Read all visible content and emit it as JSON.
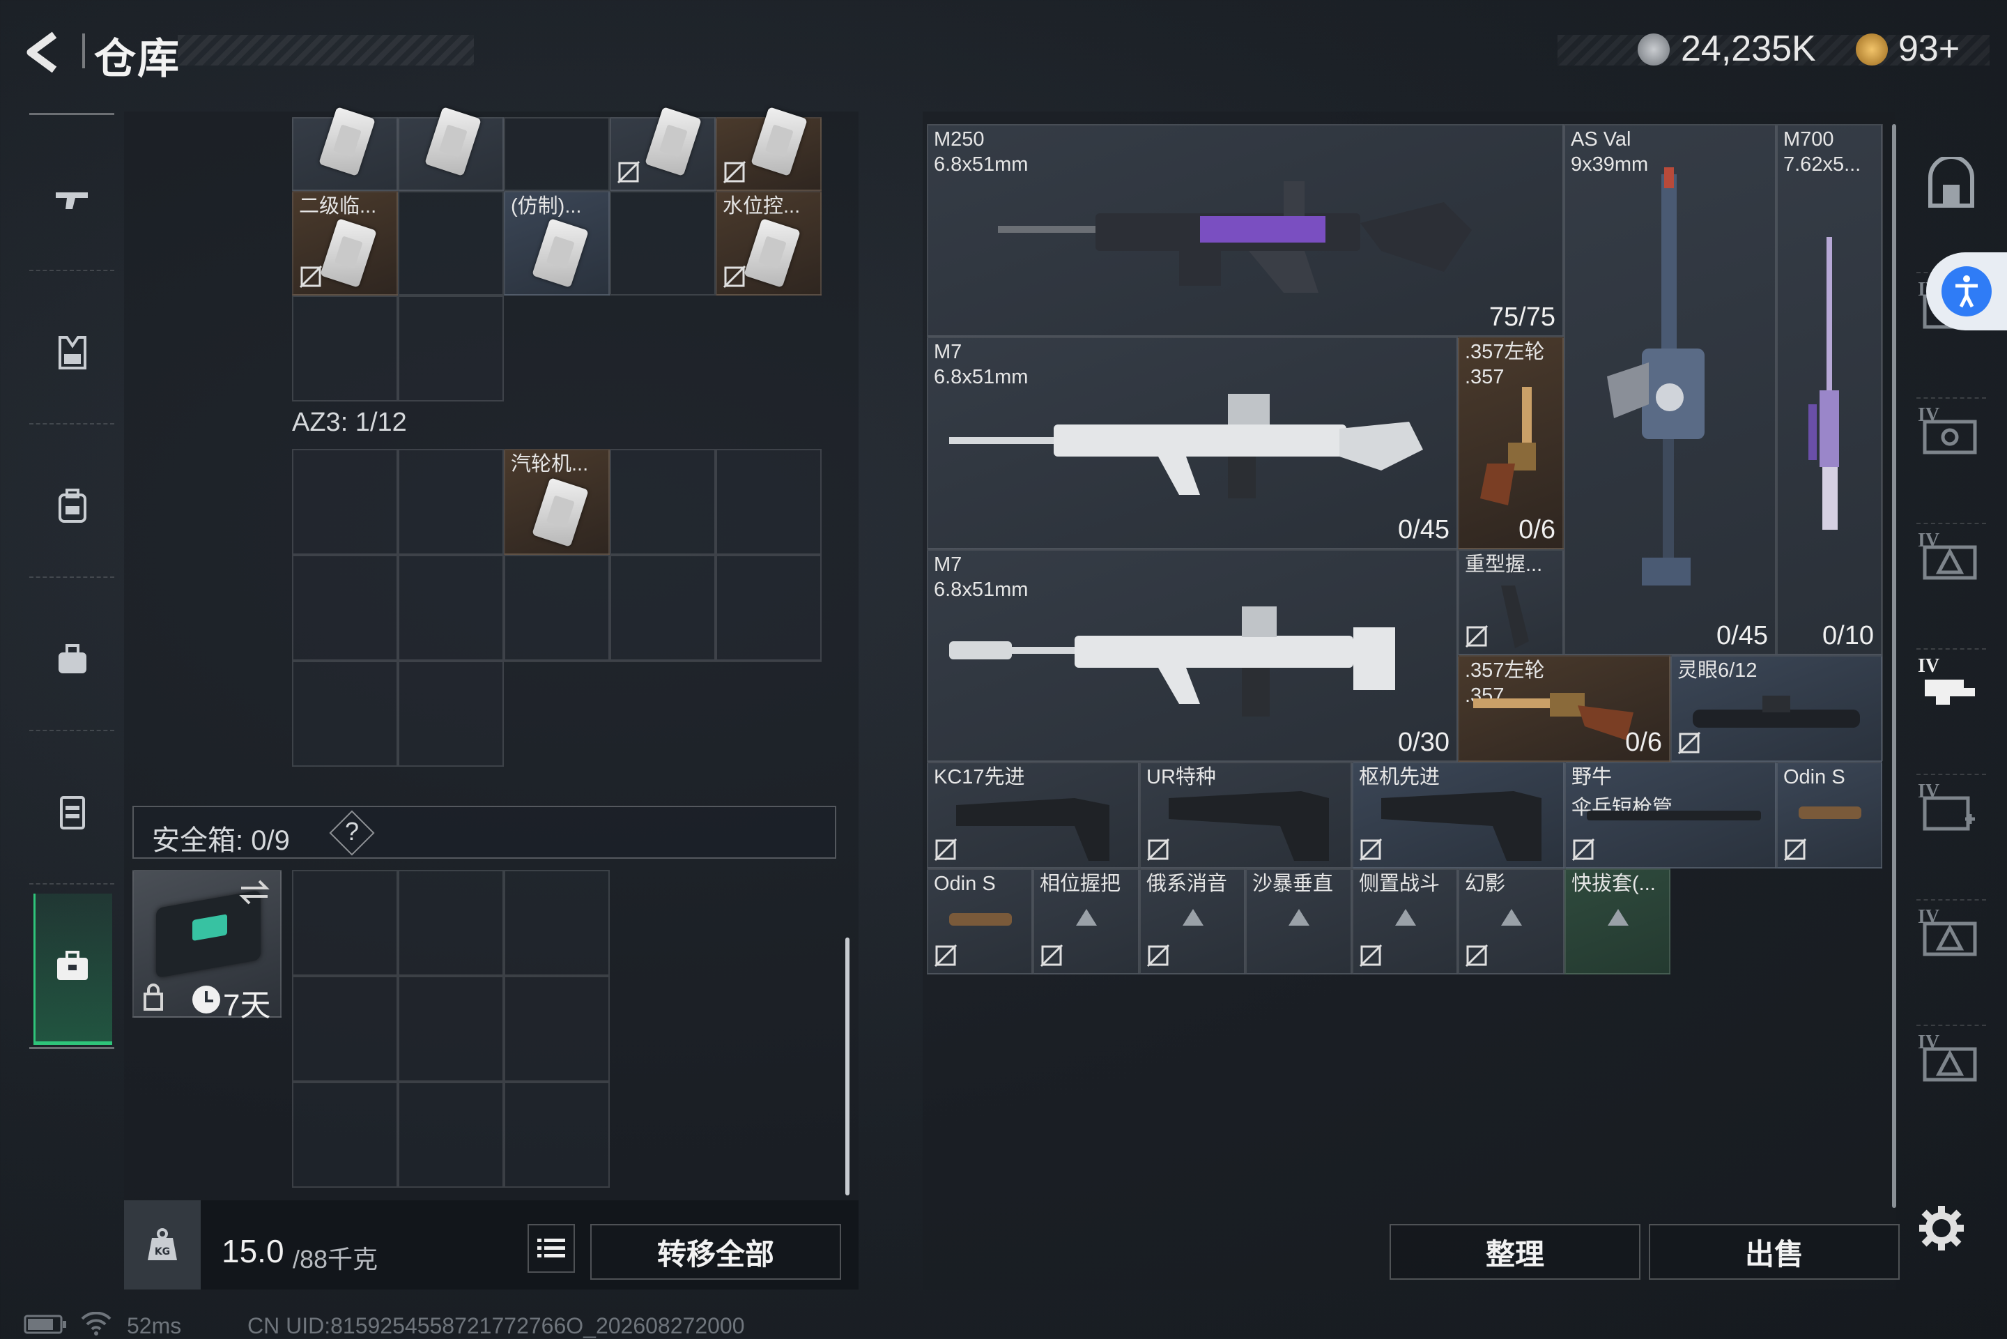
{
  "header": {
    "title": "仓库",
    "currency1": "24,235K",
    "currency2": "93+"
  },
  "left_panel": {
    "az3_label": "AZ3: 1/12",
    "items_top": [
      {
        "name": "二级临..."
      },
      {
        "name": "(仿制)..."
      },
      {
        "name": "水位控..."
      }
    ],
    "az3_item": {
      "name": "汽轮机..."
    },
    "safebox_label": "安全箱: 0/9",
    "safebox_help": "?",
    "safebox_duration": "7天",
    "weight_value": "15.0",
    "weight_max": "/88千克",
    "transfer_all": "转移全部"
  },
  "right_panel": {
    "items": [
      {
        "name": "M250",
        "sub": "6.8x51mm",
        "count": "75/75"
      },
      {
        "name": "AS Val",
        "sub": "9x39mm",
        "count": "0/45"
      },
      {
        "name": "M700",
        "sub": "7.62x5...",
        "count": "0/10"
      },
      {
        "name": "M7",
        "sub": "6.8x51mm",
        "count": "0/45"
      },
      {
        "name": ".357左轮",
        "sub": ".357",
        "count": "0/6"
      },
      {
        "name": "M7",
        "sub": "6.8x51mm",
        "count": "0/30"
      },
      {
        "name": "重型握...",
        "sub": "",
        "count": ""
      },
      {
        "name": ".357左轮",
        "sub": ".357",
        "count": "0/6"
      },
      {
        "name": "灵眼6/12",
        "sub": "",
        "count": ""
      },
      {
        "name": "KC17先进",
        "sub": "",
        "count": ""
      },
      {
        "name": "UR特种",
        "sub": "",
        "count": ""
      },
      {
        "name": "枢机先进",
        "sub": "",
        "count": ""
      },
      {
        "name": "野牛",
        "sub": "伞兵短枪管",
        "count": ""
      },
      {
        "name": "Odin S",
        "sub": "",
        "count": ""
      },
      {
        "name": "Odin S",
        "sub": "",
        "count": ""
      },
      {
        "name": "相位握把",
        "sub": "",
        "count": ""
      },
      {
        "name": "俄系消音",
        "sub": "",
        "count": ""
      },
      {
        "name": "沙暴垂直",
        "sub": "",
        "count": ""
      },
      {
        "name": "侧置战斗",
        "sub": "",
        "count": ""
      },
      {
        "name": "幻影",
        "sub": "",
        "count": ""
      },
      {
        "name": "快拔套(...",
        "sub": "",
        "count": ""
      }
    ],
    "sort_button": "整理",
    "sell_button": "出售"
  },
  "right_sidebar": {
    "tier_labels": [
      "IV",
      "IV",
      "IV",
      "IV",
      "IV",
      "IV",
      "IV"
    ]
  },
  "status_bar": {
    "ping": "52ms",
    "uid": "CN UID:8159254558721772766O_202608272000"
  },
  "colors": {
    "accent_green": "#2fc47a",
    "accessibility_blue": "#2f7cf6"
  }
}
